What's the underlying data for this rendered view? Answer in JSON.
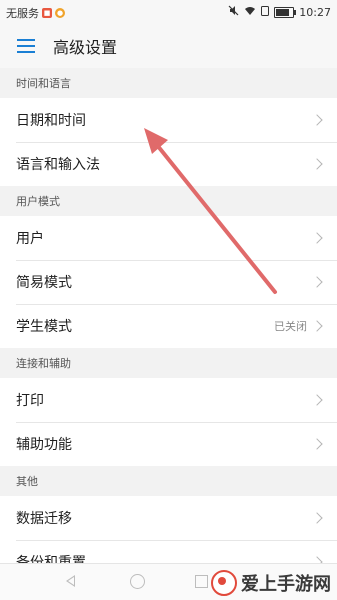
{
  "status_bar": {
    "carrier": "无服务",
    "time": "10:27",
    "battery_level": 0.8
  },
  "app_bar": {
    "title": "高级设置"
  },
  "sections": [
    {
      "header": "时间和语言",
      "items": [
        {
          "label": "日期和时间",
          "value": ""
        },
        {
          "label": "语言和输入法",
          "value": ""
        }
      ]
    },
    {
      "header": "用户模式",
      "items": [
        {
          "label": "用户",
          "value": ""
        },
        {
          "label": "简易模式",
          "value": ""
        },
        {
          "label": "学生模式",
          "value": "已关闭"
        }
      ]
    },
    {
      "header": "连接和辅助",
      "items": [
        {
          "label": "打印",
          "value": ""
        },
        {
          "label": "辅助功能",
          "value": ""
        }
      ]
    },
    {
      "header": "其他",
      "items": [
        {
          "label": "数据迁移",
          "value": ""
        },
        {
          "label": "备份和重置",
          "value": ""
        }
      ]
    }
  ],
  "watermark": {
    "text": "爱上手游网"
  },
  "colors": {
    "accent": "#1a7fd4",
    "annotation_arrow": "#e06a6a"
  }
}
